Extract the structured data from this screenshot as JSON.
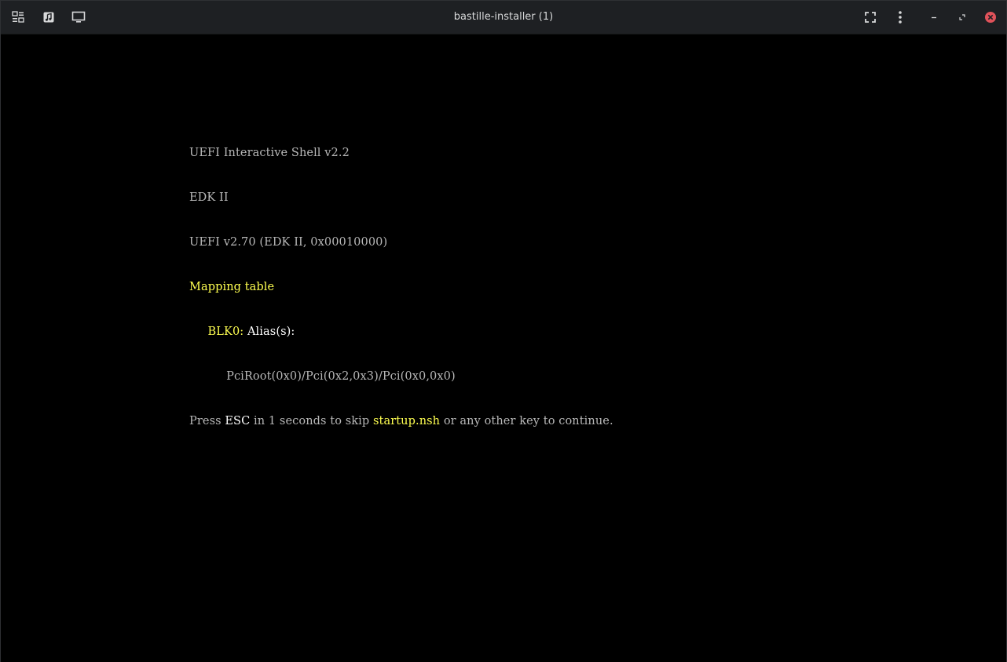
{
  "window": {
    "title": "bastille-installer (1)"
  },
  "toolbar": {
    "left_icons": [
      "tiles-icon",
      "music-note-icon",
      "monitor-icon"
    ],
    "right_icons": [
      "fullscreen-icon",
      "kebab-menu-icon",
      "minimize-icon",
      "restore-icon",
      "close-icon"
    ]
  },
  "colors": {
    "titlebar_bg": "#1e2023",
    "console_bg": "#000000",
    "console_text": "#b8b8b8",
    "console_highlight": "#ffff50",
    "console_bright": "#ffffff",
    "close_button": "#e0525a"
  },
  "console": {
    "line1": "UEFI Interactive Shell v2.2",
    "line2": "EDK II",
    "line3": "UEFI v2.70 (EDK II, 0x00010000)",
    "line4": "Mapping table",
    "line5_indent": "     ",
    "line5_device": "BLK0:",
    "line5_alias": " Alias(s):",
    "line6_indent": "          ",
    "line6_path": "PciRoot(0x0)/Pci(0x2,0x3)/Pci(0x0,0x0)",
    "line7_a": "Press ",
    "line7_esc": "ESC",
    "line7_b": " in 1 seconds to skip ",
    "line7_file": "startup.nsh",
    "line7_c": " or any other key to continue."
  }
}
